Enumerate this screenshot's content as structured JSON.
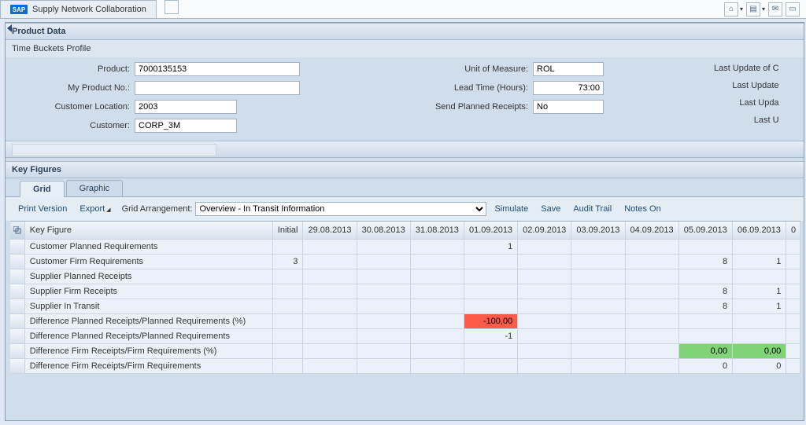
{
  "window": {
    "title": "Supply Network Collaboration"
  },
  "titlebar_icons": {
    "home": "⌂",
    "rss_square": "▤",
    "mail": "✉",
    "page": "▭"
  },
  "product_data": {
    "header": "Product Data",
    "subheader": "Time Buckets Profile",
    "labels": {
      "product": "Product:",
      "my_product_no": "My Product No.:",
      "customer_location": "Customer Location:",
      "customer": "Customer:",
      "uom": "Unit of Measure:",
      "lead_time": "Lead Time (Hours):",
      "send_planned": "Send Planned Receipts:",
      "last_update_c": "Last Update of C",
      "last_update_2": "Last Update",
      "last_upda": "Last Upda",
      "last_u": "Last U"
    },
    "values": {
      "product": "7000135153",
      "my_product_no": "",
      "customer_location": "2003",
      "customer": "CORP_3M",
      "uom": "ROL",
      "lead_time": "73:00",
      "send_planned": "No"
    }
  },
  "key_figures": {
    "header": "Key Figures",
    "tabs": {
      "grid": "Grid",
      "graphic": "Graphic"
    },
    "toolbar": {
      "print": "Print Version",
      "export": "Export",
      "grid_arrangement_label": "Grid Arrangement:",
      "grid_arrangement_value": "Overview - In Transit Information",
      "simulate": "Simulate",
      "save": "Save",
      "audit": "Audit Trail",
      "notes": "Notes On"
    },
    "columns": {
      "key_figure": "Key Figure",
      "initial": "Initial",
      "dates": [
        "29.08.2013",
        "30.08.2013",
        "31.08.2013",
        "01.09.2013",
        "02.09.2013",
        "03.09.2013",
        "04.09.2013",
        "05.09.2013",
        "06.09.2013",
        "0"
      ]
    },
    "rows": [
      {
        "label": "Customer Planned Requirements",
        "initial": "",
        "cells": [
          "",
          "",
          "",
          "1",
          "",
          "",
          "",
          "",
          ""
        ]
      },
      {
        "label": "Customer Firm Requirements",
        "initial": "3",
        "cells": [
          "",
          "",
          "",
          "",
          "",
          "",
          "",
          "8",
          "1"
        ]
      },
      {
        "label": "Supplier Planned Receipts",
        "initial": "",
        "cells": [
          "",
          "",
          "",
          "",
          "",
          "",
          "",
          "",
          ""
        ]
      },
      {
        "label": "Supplier Firm Receipts",
        "initial": "",
        "cells": [
          "",
          "",
          "",
          "",
          "",
          "",
          "",
          "8",
          "1"
        ]
      },
      {
        "label": "Supplier In Transit",
        "initial": "",
        "cells": [
          "",
          "",
          "",
          "",
          "",
          "",
          "",
          "8",
          "1"
        ]
      },
      {
        "label": "Difference Planned Receipts/Planned Requirements (%)",
        "initial": "",
        "cells": [
          "",
          "",
          "",
          "-100,00",
          "",
          "",
          "",
          "",
          ""
        ],
        "styles": {
          "3": "neg-red"
        }
      },
      {
        "label": "Difference Planned Receipts/Planned Requirements",
        "initial": "",
        "cells": [
          "",
          "",
          "",
          "-1",
          "",
          "",
          "",
          "",
          ""
        ]
      },
      {
        "label": "Difference Firm Receipts/Firm Requirements (%)",
        "initial": "",
        "cells": [
          "",
          "",
          "",
          "",
          "",
          "",
          "",
          "0,00",
          "0,00"
        ],
        "styles": {
          "7": "zero-green",
          "8": "zero-green"
        }
      },
      {
        "label": "Difference Firm Receipts/Firm Requirements",
        "initial": "",
        "cells": [
          "",
          "",
          "",
          "",
          "",
          "",
          "",
          "0",
          "0"
        ]
      }
    ]
  }
}
